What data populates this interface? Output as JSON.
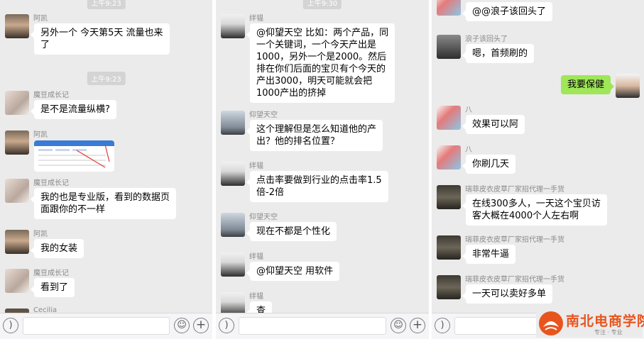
{
  "panel1": {
    "time_top": "上午9:23",
    "messages": [
      {
        "name": "阿凯",
        "text": "另外一个 今天第5天  流量也来\n了"
      },
      {
        "name": "魔豆成长记",
        "text": "是不是流量纵横?"
      },
      {
        "name": "阿凯",
        "text": ""
      },
      {
        "name": "魔豆成长记",
        "text": "我的也是专业版，看到的数据页\n面跟你的不一样"
      },
      {
        "name": "阿凯",
        "text": "我的女装"
      },
      {
        "name": "魔豆成长记",
        "text": "看到了"
      },
      {
        "name": "Cecilia",
        "text": ""
      }
    ],
    "time_mid": "上午9:23"
  },
  "panel2": {
    "time_top": "上午9:30",
    "messages": [
      {
        "name": "绊韫",
        "text": "@仰望天空 比如：两个产品，同\n一个关键词，一个今天产出是\n1000，另外一个是2000。然后\n排在你们后面的宝贝有个今天的\n产出3000，明天可能就会把\n1000产出的挤掉"
      },
      {
        "name": "仰望天空",
        "text": "这个理解但是怎么知道他的产\n出？他的排名位置？"
      },
      {
        "name": "绊韫",
        "text": "点击率要做到行业的点击率1.5\n倍-2倍"
      },
      {
        "name": "仰望天空",
        "text": "现在不都是个性化"
      },
      {
        "name": "绊韫",
        "text": "@仰望天空 用软件"
      },
      {
        "name": "绊韫",
        "text": "查"
      }
    ]
  },
  "panel3": {
    "messages": [
      {
        "name": "",
        "text": "@@浪子该回头了"
      },
      {
        "name": "浪子该回头了",
        "text": "嗯，首频刷的"
      },
      {
        "name": "",
        "text": "我要保健"
      },
      {
        "name": "八",
        "text": "效果可以阿"
      },
      {
        "name": "八",
        "text": "你刷几天"
      },
      {
        "name": "瑞菲皮衣皮草厂家招代理一手货",
        "text": "在线300多人，一天这个宝贝访\n客大概在4000个人左右啊"
      },
      {
        "name": "瑞菲皮衣皮草厂家招代理一手货",
        "text": "非常牛逼"
      },
      {
        "name": "瑞菲皮衣皮草厂家招代理一手货",
        "text": "一天可以卖好多单"
      }
    ]
  },
  "watermark": {
    "title": "南北电商学院",
    "slogan": "专注 · 专业"
  },
  "colors": {
    "background": "#ebebeb",
    "green_bubble": "#9fe658",
    "watermark": "#e8541e"
  }
}
